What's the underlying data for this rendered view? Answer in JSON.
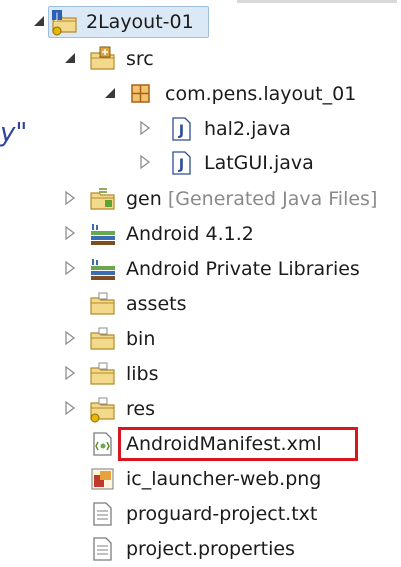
{
  "tree": {
    "items": [
      {
        "label": "2Layout-01",
        "decor": "",
        "state": "expanded",
        "icon": "android-project-icon",
        "selected": true
      },
      {
        "label": "src",
        "decor": "",
        "state": "expanded",
        "icon": "source-folder-icon"
      },
      {
        "label": "com.pens.layout_01",
        "decor": "",
        "state": "expanded",
        "icon": "package-icon"
      },
      {
        "label": "hal2.java",
        "decor": "",
        "state": "collapsed",
        "icon": "java-file-icon"
      },
      {
        "label": "LatGUI.java",
        "decor": "",
        "state": "collapsed",
        "icon": "java-file-icon"
      },
      {
        "label": "gen",
        "decor": "[Generated Java Files]",
        "state": "collapsed",
        "icon": "generated-folder-icon"
      },
      {
        "label": "Android 4.1.2",
        "decor": "",
        "state": "collapsed",
        "icon": "library-icon"
      },
      {
        "label": "Android Private Libraries",
        "decor": "",
        "state": "collapsed",
        "icon": "library-icon"
      },
      {
        "label": "assets",
        "decor": "",
        "state": "none",
        "icon": "folder-icon"
      },
      {
        "label": "bin",
        "decor": "",
        "state": "collapsed",
        "icon": "folder-icon"
      },
      {
        "label": "libs",
        "decor": "",
        "state": "collapsed",
        "icon": "folder-icon"
      },
      {
        "label": "res",
        "decor": "",
        "state": "collapsed",
        "icon": "resource-folder-icon"
      },
      {
        "label": "AndroidManifest.xml",
        "decor": "",
        "state": "none",
        "icon": "xml-file-icon",
        "highlighted": true
      },
      {
        "label": "ic_launcher-web.png",
        "decor": "",
        "state": "none",
        "icon": "image-file-icon"
      },
      {
        "label": "proguard-project.txt",
        "decor": "",
        "state": "none",
        "icon": "text-file-icon"
      },
      {
        "label": "project.properties",
        "decor": "",
        "state": "none",
        "icon": "text-file-icon"
      }
    ]
  },
  "stray_text": "y\"",
  "colors": {
    "highlight": "#d7171f",
    "selection": "#dbe8f6"
  }
}
